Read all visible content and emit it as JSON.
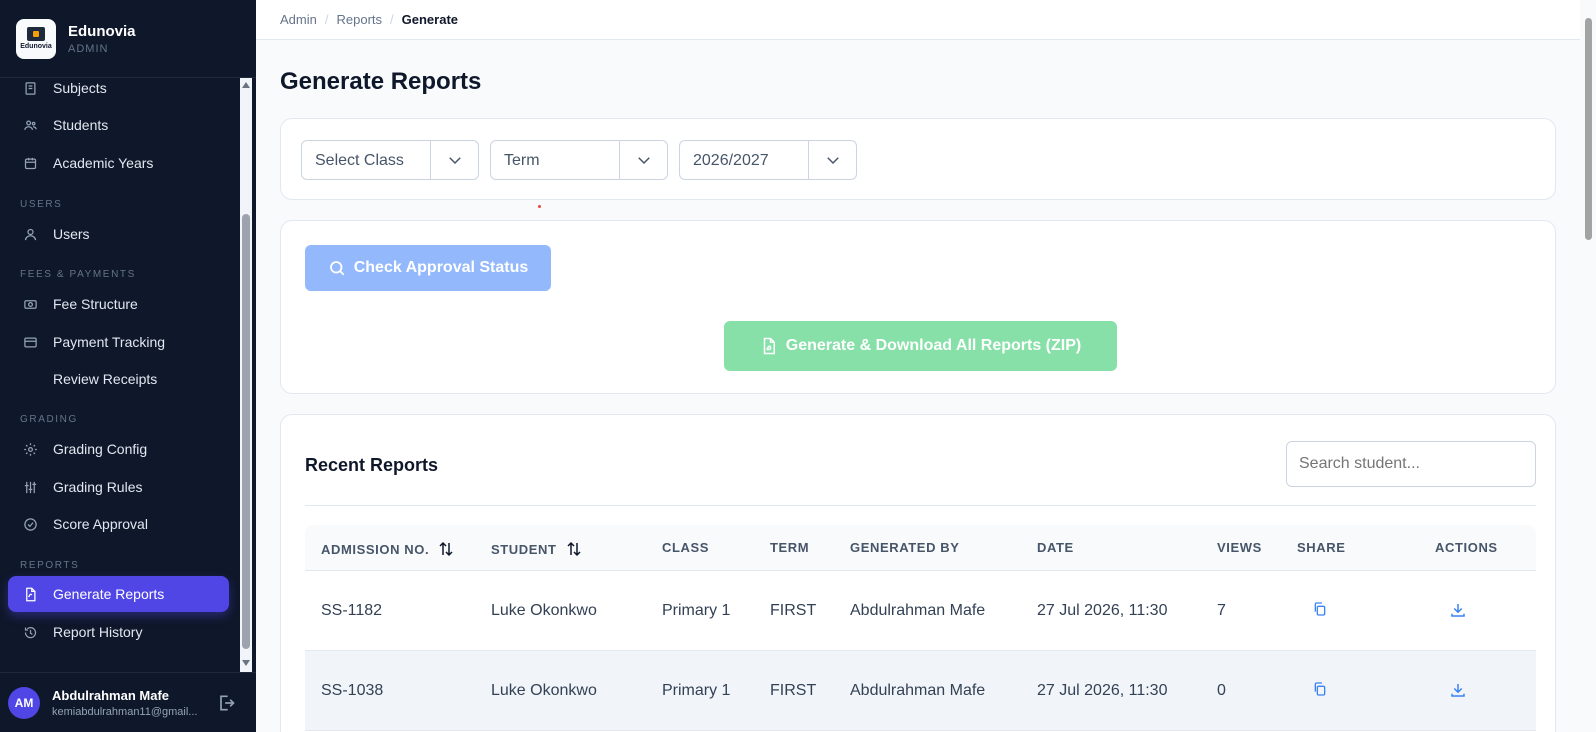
{
  "brand": {
    "name": "Edunovia",
    "role": "ADMIN",
    "logo_text": "Edunovia"
  },
  "sidebar": {
    "items": [
      {
        "label": "Subjects",
        "icon": "book-icon"
      },
      {
        "label": "Students",
        "icon": "users-icon"
      },
      {
        "label": "Academic Years",
        "icon": "calendar-icon"
      },
      {
        "label": "Users",
        "icon": "user-icon"
      },
      {
        "label": "Fee Structure",
        "icon": "money-icon"
      },
      {
        "label": "Payment Tracking",
        "icon": "credit-card-icon"
      },
      {
        "label": "Review Receipts",
        "icon": ""
      },
      {
        "label": "Grading Config",
        "icon": "gear-icon"
      },
      {
        "label": "Grading Rules",
        "icon": "sliders-icon"
      },
      {
        "label": "Score Approval",
        "icon": "check-circle-icon"
      },
      {
        "label": "Generate Reports",
        "icon": "file-icon",
        "active": true
      },
      {
        "label": "Report History",
        "icon": "history-icon"
      }
    ],
    "sections": {
      "users": "USERS",
      "fees": "FEES & PAYMENTS",
      "grading": "GRADING",
      "reports": "REPORTS"
    }
  },
  "user": {
    "initials": "AM",
    "name": "Abdulrahman Mafe",
    "email": "kemiabdulrahman11@gmail..."
  },
  "breadcrumb": [
    "Admin",
    "Reports",
    "Generate"
  ],
  "page": {
    "title": "Generate Reports"
  },
  "filters": {
    "class": "Select Class",
    "term": "Term",
    "year": "2026/2027"
  },
  "buttons": {
    "check": "Check Approval Status",
    "generate": "Generate & Download All Reports (ZIP)"
  },
  "reports": {
    "title": "Recent Reports",
    "search_placeholder": "Search student...",
    "columns": [
      "ADMISSION NO.",
      "STUDENT",
      "CLASS",
      "TERM",
      "GENERATED BY",
      "DATE",
      "VIEWS",
      "SHARE",
      "ACTIONS"
    ],
    "rows": [
      {
        "admission": "SS-1182",
        "student": "Luke Okonkwo",
        "class": "Primary 1",
        "term": "FIRST",
        "generated_by": "Abdulrahman Mafe",
        "date": "27 Jul 2026, 11:30",
        "views": "7"
      },
      {
        "admission": "SS-1038",
        "student": "Luke Okonkwo",
        "class": "Primary 1",
        "term": "FIRST",
        "generated_by": "Abdulrahman Mafe",
        "date": "27 Jul 2026, 11:30",
        "views": "0"
      }
    ]
  },
  "colors": {
    "sidebar_bg": "#0f172a",
    "active": "#4f46e5",
    "check_button": "#93b8fb",
    "generate_button": "#86e0a8"
  }
}
